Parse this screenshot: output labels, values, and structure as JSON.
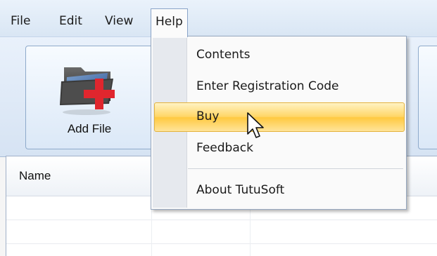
{
  "menubar": {
    "items": [
      {
        "label": "File"
      },
      {
        "label": "Edit"
      },
      {
        "label": "View"
      },
      {
        "label": "Help"
      }
    ]
  },
  "toolbar": {
    "add_file_label": "Add File"
  },
  "help_menu": {
    "items": [
      {
        "label": "Contents"
      },
      {
        "label": "Enter Registration Code"
      },
      {
        "label": "Buy"
      },
      {
        "label": "Feedback"
      },
      {
        "label": "About TutuSoft"
      }
    ],
    "highlighted": "Buy"
  },
  "file_list": {
    "columns": [
      "Name"
    ]
  },
  "colors": {
    "highlight": "#ffd667",
    "menubar": "#dfe9f5",
    "accent_red": "#e0262e"
  },
  "icons": {
    "add_file": "folder-add-icon",
    "pointer": "mouse-pointer-icon"
  }
}
